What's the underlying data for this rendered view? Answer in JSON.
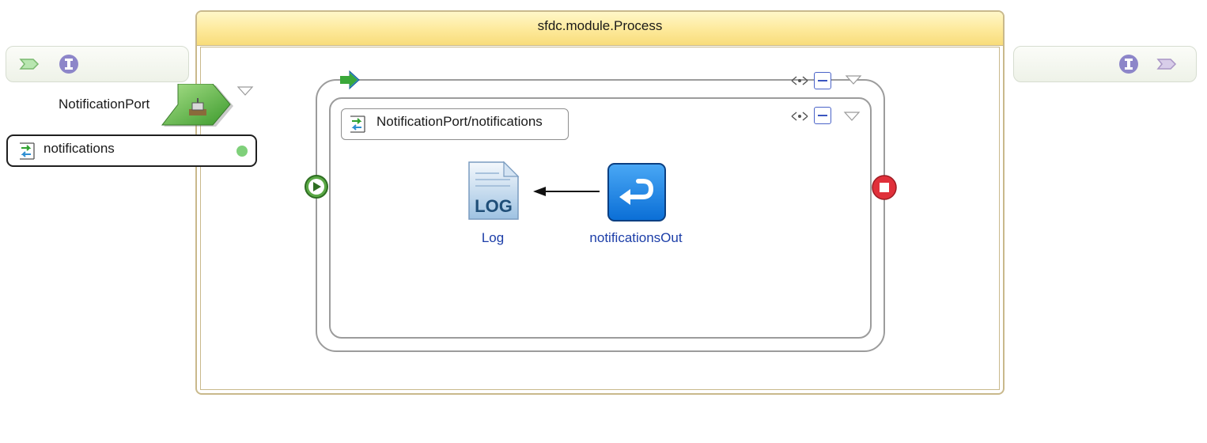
{
  "process": {
    "title": "sfdc.module.Process"
  },
  "export": {
    "port_name": "NotificationPort",
    "interface_name": "notifications"
  },
  "flow": {
    "label": "NotificationPort/notifications"
  },
  "nodes": {
    "log_label": "Log",
    "log_icon_text": "LOG",
    "out_label": "notificationsOut"
  },
  "icons": {
    "palette_left": [
      "reference-arrow-icon",
      "interface-icon"
    ],
    "palette_right": [
      "interface-icon",
      "reference-arrow-icon"
    ],
    "start": "play-icon",
    "stop": "stop-icon"
  },
  "colors": {
    "header": "#fde99a",
    "start": "#5aa845",
    "stop": "#e0303a",
    "node_blue": "#1a86e8",
    "link": "#1c3ea8"
  }
}
